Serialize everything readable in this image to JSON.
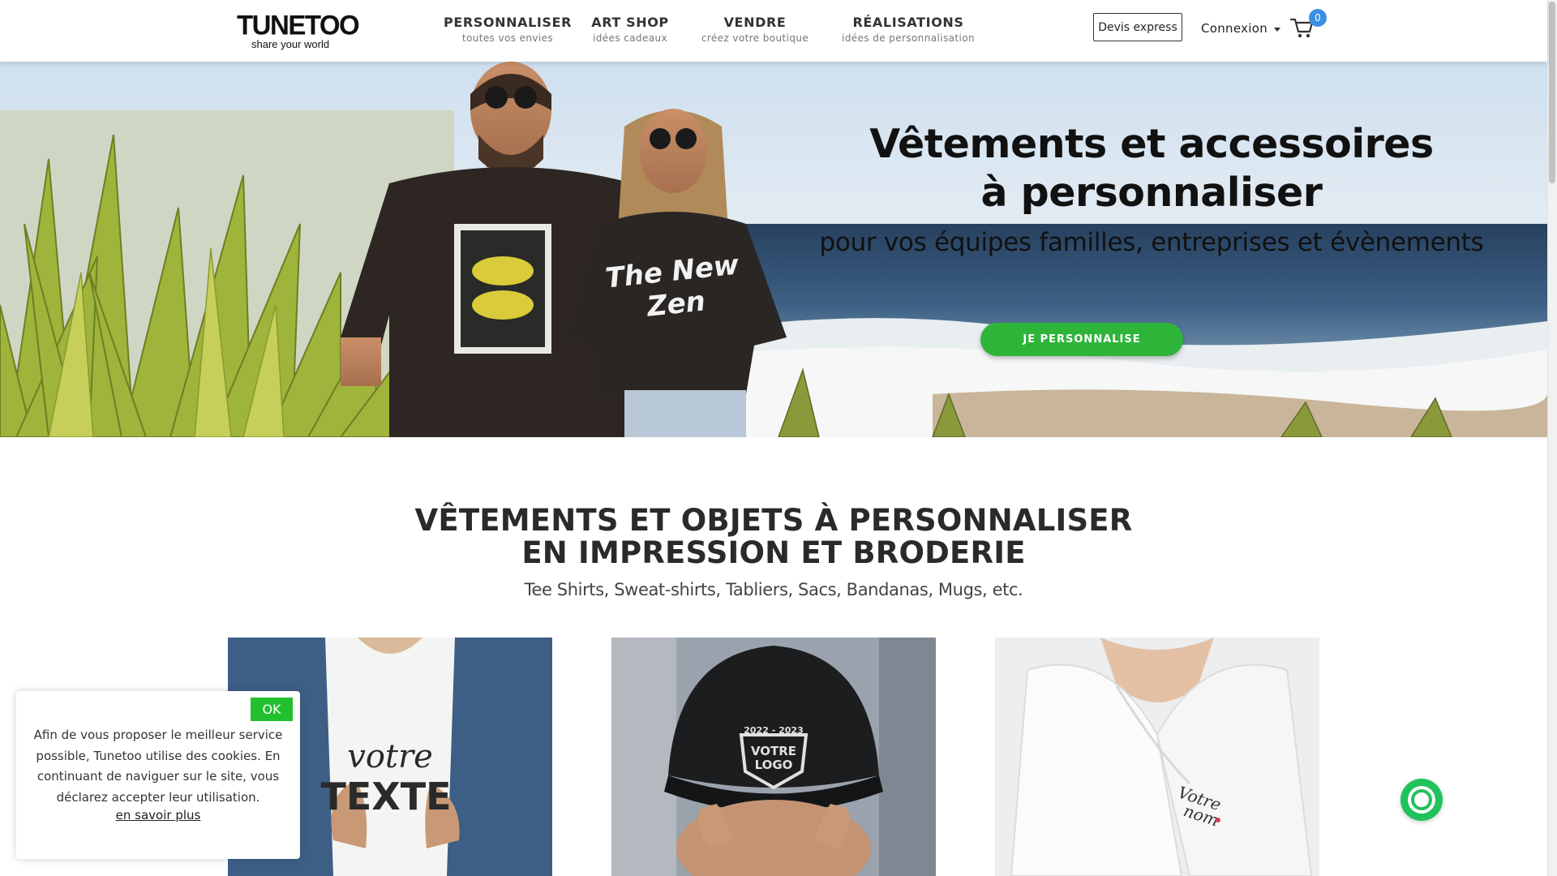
{
  "header": {
    "logo_main": "TUNETOO",
    "logo_sub": "share your world",
    "nav": [
      {
        "title": "PERSONNALISER",
        "sub": "toutes vos envies"
      },
      {
        "title": "ART SHOP",
        "sub": "idées cadeaux"
      },
      {
        "title": "VENDRE",
        "sub": "créez votre boutique"
      },
      {
        "title": "RÉALISATIONS",
        "sub": "idées de personnalisation"
      }
    ],
    "devis_label": "Devis express",
    "connexion_label": "Connexion",
    "cart_count": "0"
  },
  "hero": {
    "title_line1": "Vêtements et accessoires",
    "title_line2": "à personnaliser",
    "subtitle": "pour vos équipes familles, entreprises et évènements",
    "cta": "JE PERSONNALISE",
    "shirt_text_line1": "The New",
    "shirt_text_line2": "Zen"
  },
  "section": {
    "title_line1": "VÊTEMENTS ET OBJETS À PERSONNALISER",
    "title_line2": "EN IMPRESSION ET BRODERIE",
    "subtitle": "Tee Shirts, Sweat-shirts, Tabliers, Sacs, Bandanas, Mugs, etc."
  },
  "cards": [
    {
      "print_line1": "votre",
      "print_line2": "TEXTE"
    },
    {
      "print_line1": "2022 - 2023",
      "print_line2": "VOTRE",
      "print_line3": "LOGO"
    },
    {
      "print_line1": "Votre",
      "print_line2": "nom"
    }
  ],
  "cookie": {
    "ok_label": "OK",
    "text": "Afin de vous proposer le meilleur service possible, Tunetoo utilise des cookies. En continuant de naviguer sur le site, vous déclarez accepter leur utilisation.",
    "link_label": "en savoir plus"
  },
  "colors": {
    "accent_green": "#2fb43a",
    "badge_blue": "#3b8fe4",
    "chat_green": "#20c25a"
  }
}
